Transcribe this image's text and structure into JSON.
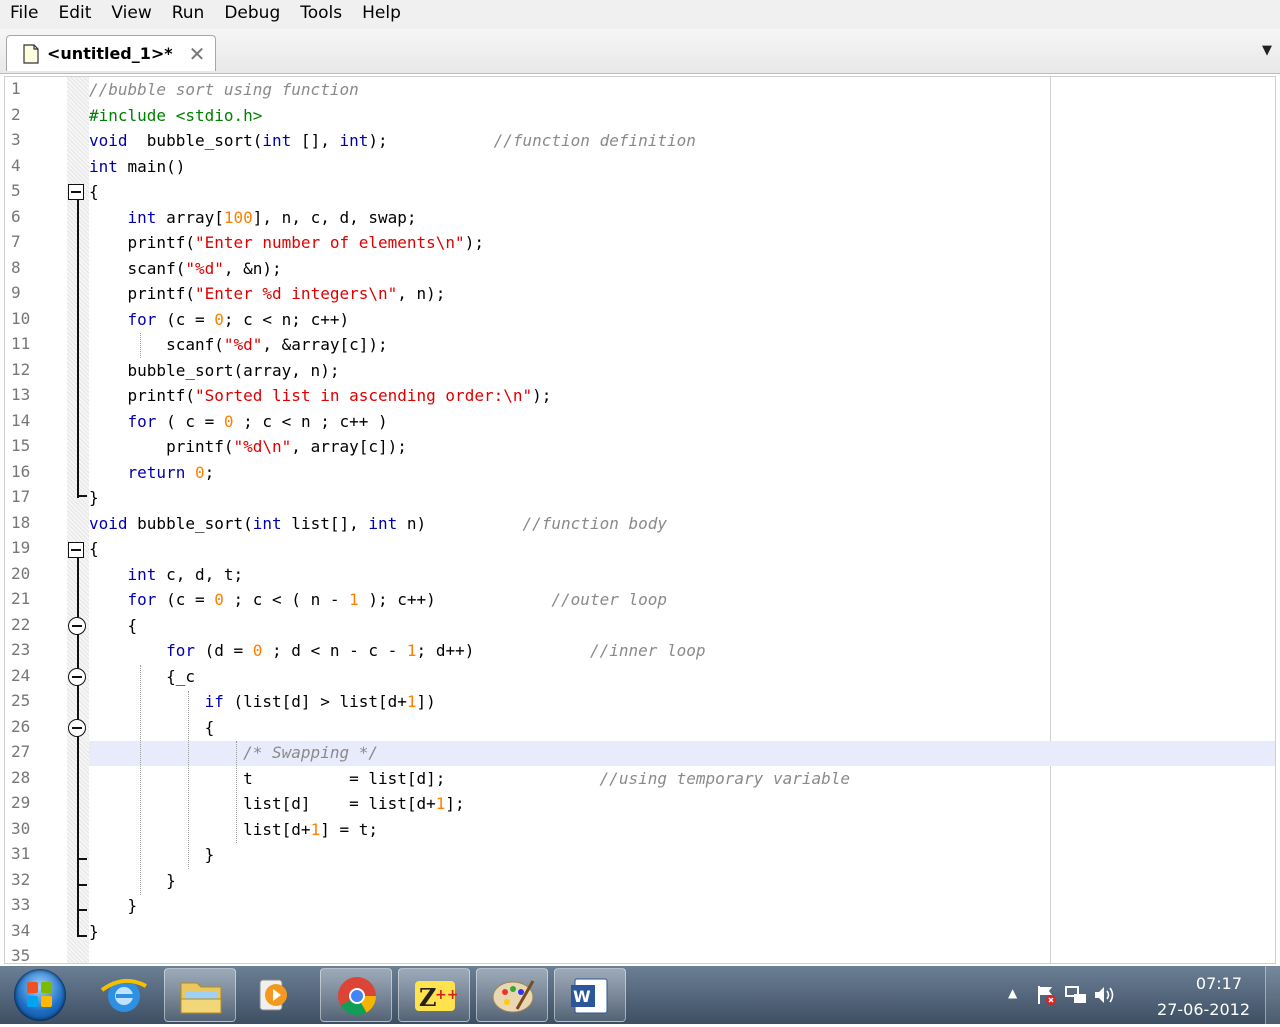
{
  "menu": [
    "File",
    "Edit",
    "View",
    "Run",
    "Debug",
    "Tools",
    "Help"
  ],
  "tab": {
    "title": "<untitled_1>*",
    "close": "✕",
    "dropdown": "▼"
  },
  "editor": {
    "line_numbers": [
      "1",
      "2",
      "3",
      "4",
      "5",
      "6",
      "7",
      "8",
      "9",
      "10",
      "11",
      "12",
      "13",
      "14",
      "15",
      "16",
      "17",
      "18",
      "19",
      "20",
      "21",
      "22",
      "23",
      "24",
      "25",
      "26",
      "27",
      "28",
      "29",
      "30",
      "31",
      "32",
      "33",
      "34",
      "35"
    ],
    "lines": [
      [
        [
          "cmt",
          "//bubble sort using function"
        ]
      ],
      [
        [
          "pp",
          "#include <stdio.h>"
        ]
      ],
      [
        [
          "kw",
          "void"
        ],
        [
          "",
          "  bubble_sort("
        ],
        [
          "kw",
          "int"
        ],
        [
          "",
          " [], "
        ],
        [
          "kw",
          "int"
        ],
        [
          "",
          ");           "
        ],
        [
          "cmt",
          "//function definition"
        ]
      ],
      [
        [
          "kw",
          "int"
        ],
        [
          "",
          " main()"
        ]
      ],
      [
        [
          "",
          "{"
        ]
      ],
      [
        [
          "",
          "    "
        ],
        [
          "kw",
          "int"
        ],
        [
          "",
          " array["
        ],
        [
          "num",
          "100"
        ],
        [
          "",
          "], n, c, d, swap;"
        ]
      ],
      [
        [
          "",
          "    printf("
        ],
        [
          "str",
          "\"Enter number of elements\\n\""
        ],
        [
          "",
          ");"
        ]
      ],
      [
        [
          "",
          "    scanf("
        ],
        [
          "str",
          "\"%d\""
        ],
        [
          "",
          ", &n);"
        ]
      ],
      [
        [
          "",
          "    printf("
        ],
        [
          "str",
          "\"Enter %d integers\\n\""
        ],
        [
          "",
          ", n);"
        ]
      ],
      [
        [
          "",
          "    "
        ],
        [
          "kw",
          "for"
        ],
        [
          "",
          " (c = "
        ],
        [
          "num",
          "0"
        ],
        [
          "",
          "; c < n; c++)"
        ]
      ],
      [
        [
          "",
          "        scanf("
        ],
        [
          "str",
          "\"%d\""
        ],
        [
          "",
          ", &array[c]);"
        ]
      ],
      [
        [
          "",
          "    bubble_sort(array, n);"
        ]
      ],
      [
        [
          "",
          "    printf("
        ],
        [
          "str",
          "\"Sorted list in ascending order:\\n\""
        ],
        [
          "",
          ");"
        ]
      ],
      [
        [
          "",
          "    "
        ],
        [
          "kw",
          "for"
        ],
        [
          "",
          " ( c = "
        ],
        [
          "num",
          "0"
        ],
        [
          "",
          " ; c < n ; c++ )"
        ]
      ],
      [
        [
          "",
          "        printf("
        ],
        [
          "str",
          "\"%d\\n\""
        ],
        [
          "",
          ", array[c]);"
        ]
      ],
      [
        [
          "",
          "    "
        ],
        [
          "kw",
          "return"
        ],
        [
          "",
          " "
        ],
        [
          "num",
          "0"
        ],
        [
          "",
          ";"
        ]
      ],
      [
        [
          "",
          "}"
        ]
      ],
      [
        [
          "kw",
          "void"
        ],
        [
          "",
          " bubble_sort("
        ],
        [
          "kw",
          "int"
        ],
        [
          "",
          " list[], "
        ],
        [
          "kw",
          "int"
        ],
        [
          "",
          " n)          "
        ],
        [
          "cmt",
          "//function body"
        ]
      ],
      [
        [
          "",
          "{"
        ]
      ],
      [
        [
          "",
          "    "
        ],
        [
          "kw",
          "int"
        ],
        [
          "",
          " c, d, t;"
        ]
      ],
      [
        [
          "",
          "    "
        ],
        [
          "kw",
          "for"
        ],
        [
          "",
          " (c = "
        ],
        [
          "num",
          "0"
        ],
        [
          "",
          " ; c < ( n - "
        ],
        [
          "num",
          "1"
        ],
        [
          "",
          " ); c++)            "
        ],
        [
          "cmt",
          "//outer loop"
        ]
      ],
      [
        [
          "",
          "    {"
        ]
      ],
      [
        [
          "",
          "        "
        ],
        [
          "kw",
          "for"
        ],
        [
          "",
          " (d = "
        ],
        [
          "num",
          "0"
        ],
        [
          "",
          " ; d < n - c - "
        ],
        [
          "num",
          "1"
        ],
        [
          "",
          "; d++)            "
        ],
        [
          "cmt",
          "//inner loop"
        ]
      ],
      [
        [
          "",
          "        {_c"
        ]
      ],
      [
        [
          "",
          "            "
        ],
        [
          "kw",
          "if"
        ],
        [
          "",
          " (list[d] > list[d+"
        ],
        [
          "num",
          "1"
        ],
        [
          "",
          "])"
        ]
      ],
      [
        [
          "",
          "            {"
        ]
      ],
      [
        [
          "",
          "                "
        ],
        [
          "cmt",
          "/* Swapping */"
        ]
      ],
      [
        [
          "",
          "                t          = list[d];                "
        ],
        [
          "cmt",
          "//using temporary variable"
        ]
      ],
      [
        [
          "",
          "                list[d]    = list[d+"
        ],
        [
          "num",
          "1"
        ],
        [
          "",
          "];"
        ]
      ],
      [
        [
          "",
          "                list[d+"
        ],
        [
          "num",
          "1"
        ],
        [
          "",
          "] = t;"
        ]
      ],
      [
        [
          "",
          "            }"
        ]
      ],
      [
        [
          "",
          "        }"
        ]
      ],
      [
        [
          "",
          "    }"
        ]
      ],
      [
        [
          "",
          "}"
        ]
      ],
      [
        [
          "",
          ""
        ]
      ]
    ]
  },
  "taskbar": {
    "apps": [
      "internet-explorer",
      "windows-explorer",
      "media-player",
      "chrome",
      "zplus-ide",
      "paint",
      "word"
    ],
    "clock_time": "07:17",
    "clock_date": "27-06-2012",
    "tray_arrow": "▲"
  },
  "colors": {
    "keyword": "#0000b0",
    "preprocessor": "#008000",
    "string": "#e00000",
    "number": "#ff8000",
    "comment": "#8a8a8a"
  }
}
